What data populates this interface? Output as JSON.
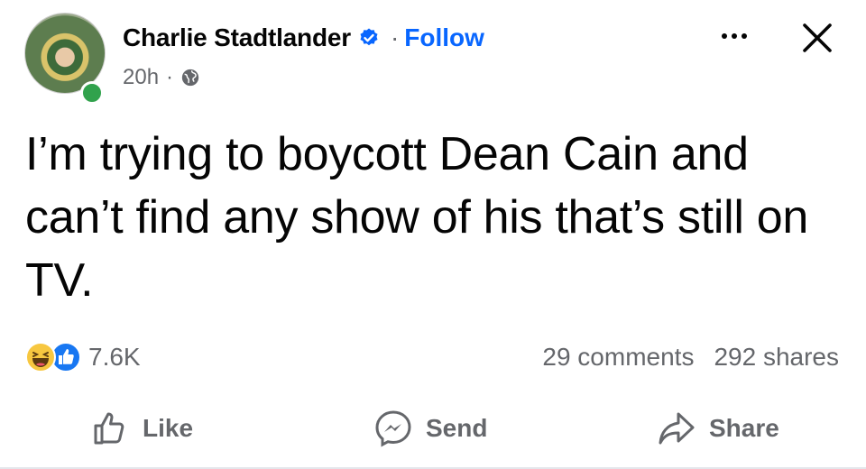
{
  "post": {
    "author": "Charlie Stadtlander",
    "follow_label": "Follow",
    "separator": "·",
    "time": "20h",
    "meta_sep": "·",
    "text": "I’m trying to boycott Dean Cain and can’t find any show of his that’s still on TV.",
    "reaction_count": "7.6K",
    "comments": "29 comments",
    "shares": "292 shares"
  },
  "actions": {
    "like": "Like",
    "send": "Send",
    "share": "Share"
  },
  "icons": {
    "verified": "verified-badge-icon",
    "globe": "globe-icon",
    "more": "more-dots-icon",
    "close": "close-icon",
    "haha": "haha-reaction-icon",
    "like_reaction": "like-reaction-icon",
    "like": "thumbs-up-icon",
    "send": "messenger-icon",
    "share": "share-arrow-icon"
  },
  "colors": {
    "link": "#0866ff",
    "text": "#050505",
    "secondary": "#65676b",
    "online": "#31a24c"
  }
}
